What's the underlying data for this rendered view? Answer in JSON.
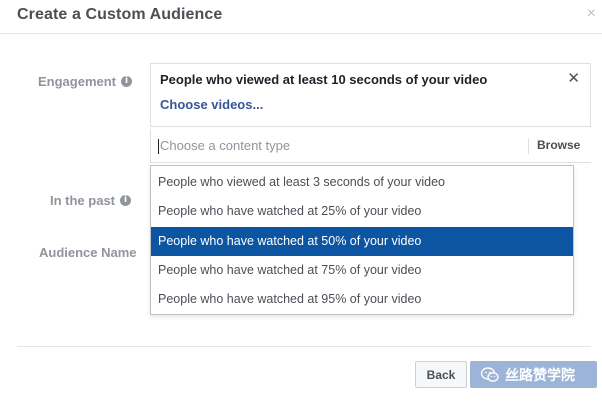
{
  "dialog": {
    "title": "Create a Custom Audience",
    "close_icon": "close-icon"
  },
  "labels": {
    "engagement": "Engagement",
    "in_the_past": "In the past",
    "audience_name": "Audience Name",
    "info_glyph": "i"
  },
  "engagement_box": {
    "selected": "People who viewed at least 10 seconds of your video",
    "choose_videos": "Choose videos...",
    "remove_glyph": "✕"
  },
  "content_type": {
    "placeholder": "Choose a content type",
    "browse_label": "Browse"
  },
  "dropdown": {
    "options": [
      "People who viewed at least 3 seconds of your video",
      "People who have watched at 25% of your video",
      "People who have watched at 50% of your video",
      "People who have watched at 75% of your video",
      "People who have watched at 95% of your video"
    ],
    "selected_index": 2
  },
  "footer": {
    "back_label": "Back",
    "watermark_text": "丝路赞学院"
  },
  "colors": {
    "accent": "#365899",
    "selected_bg": "#0c55a3",
    "create_button": "#9cb4d8"
  }
}
